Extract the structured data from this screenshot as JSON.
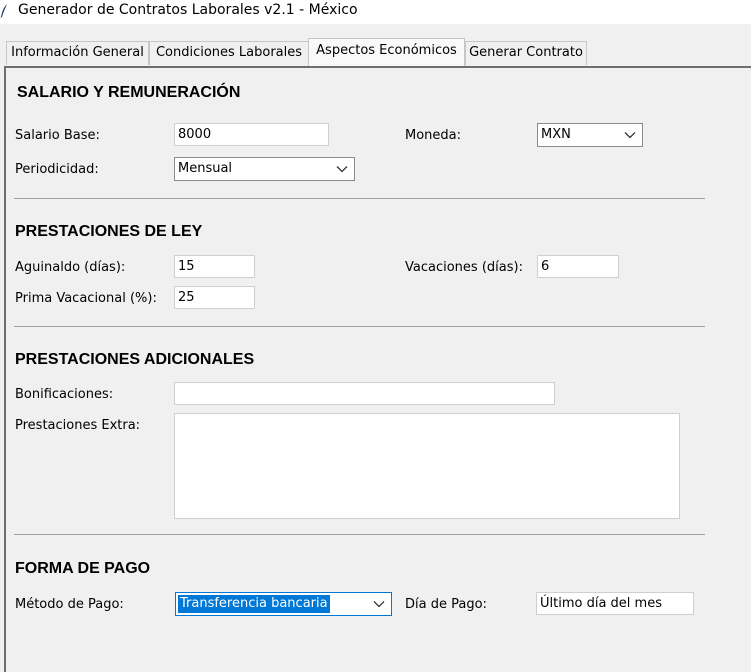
{
  "window": {
    "title": "Generador de Contratos Laborales v2.1 - México"
  },
  "tabs": [
    {
      "label": "Información General"
    },
    {
      "label": "Condiciones Laborales"
    },
    {
      "label": "Aspectos Económicos"
    },
    {
      "label": "Generar Contrato"
    }
  ],
  "salario": {
    "title": "SALARIO Y REMUNERACIÓN",
    "base_label": "Salario Base:",
    "base_value": "8000",
    "moneda_label": "Moneda:",
    "moneda_value": "MXN",
    "periodicidad_label": "Periodicidad:",
    "periodicidad_value": "Mensual"
  },
  "prestaciones_ley": {
    "title": "PRESTACIONES DE LEY",
    "aguinaldo_label": "Aguinaldo (días):",
    "aguinaldo_value": "15",
    "vacaciones_label": "Vacaciones (días):",
    "vacaciones_value": "6",
    "prima_label": "Prima Vacacional (%):",
    "prima_value": "25"
  },
  "prestaciones_adicionales": {
    "title": "PRESTACIONES ADICIONALES",
    "bonificaciones_label": "Bonificaciones:",
    "bonificaciones_value": "",
    "extra_label": "Prestaciones Extra:",
    "extra_value": ""
  },
  "forma_pago": {
    "title": "FORMA DE PAGO",
    "metodo_label": "Método de Pago:",
    "metodo_value": "Transferencia bancaria",
    "dia_label": "Día de Pago:",
    "dia_value": "Último día del mes"
  }
}
